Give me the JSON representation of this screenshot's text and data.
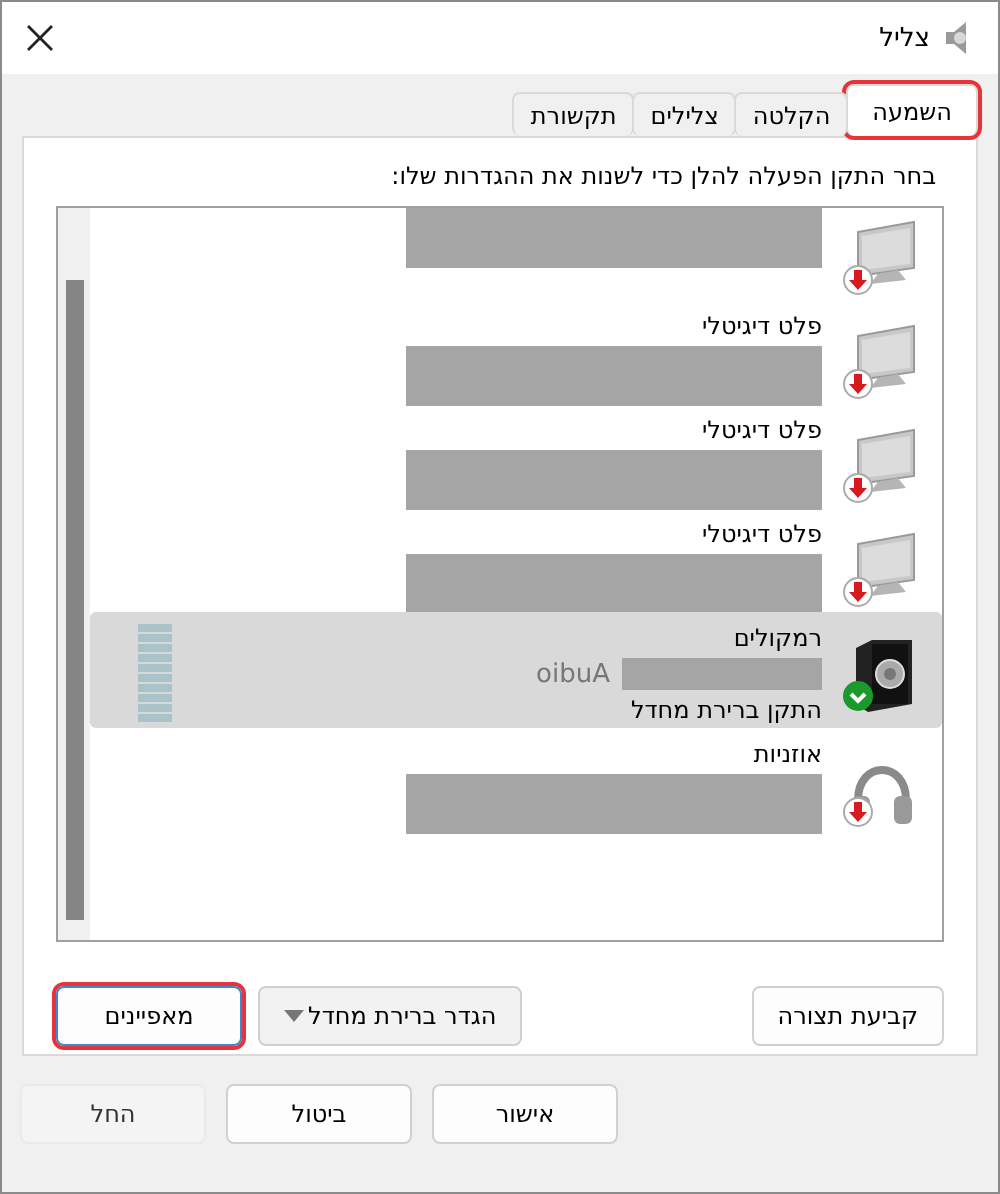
{
  "window": {
    "title": "צליל"
  },
  "tabs": [
    {
      "label": "השמעה",
      "selected": true,
      "highlighted": true
    },
    {
      "label": "הקלטה",
      "selected": false,
      "highlighted": false
    },
    {
      "label": "צלילים",
      "selected": false,
      "highlighted": false
    },
    {
      "label": "תקשורת",
      "selected": false,
      "highlighted": false
    }
  ],
  "instruction": "בחר התקן הפעלה להלן כדי לשנות את ההגדרות שלו:",
  "devices": [
    {
      "kind": "monitor",
      "default": false,
      "selected": false,
      "redacted": true
    },
    {
      "kind": "monitor",
      "name": "פלט דיגיטלי",
      "default": false,
      "selected": false,
      "redacted": true
    },
    {
      "kind": "monitor",
      "name": "פלט דיגיטלי",
      "default": false,
      "selected": false,
      "redacted": true
    },
    {
      "kind": "monitor",
      "name": "פלט דיגיטלי",
      "default": false,
      "selected": false,
      "redacted": true
    },
    {
      "kind": "speaker",
      "name": "רמקולים",
      "detail": "oibuA",
      "status_text": "התקן ברירת מחדל",
      "default": true,
      "selected": true,
      "redacted": true
    },
    {
      "kind": "headphones",
      "name": "אוזניות",
      "default": false,
      "selected": false,
      "redacted": true
    }
  ],
  "actions": [
    {
      "kind": "plain",
      "label": "קביעת תצורה",
      "highlighted": false
    },
    {
      "kind": "split",
      "label": "הגדר ברירת מחדל",
      "highlighted": false
    },
    {
      "kind": "plain",
      "label": "מאפיינים",
      "highlighted": true
    }
  ],
  "footer_buttons": [
    {
      "label": "אישור",
      "disabled": false
    },
    {
      "label": "ביטול",
      "disabled": false
    },
    {
      "label": "החל",
      "disabled": true
    }
  ]
}
